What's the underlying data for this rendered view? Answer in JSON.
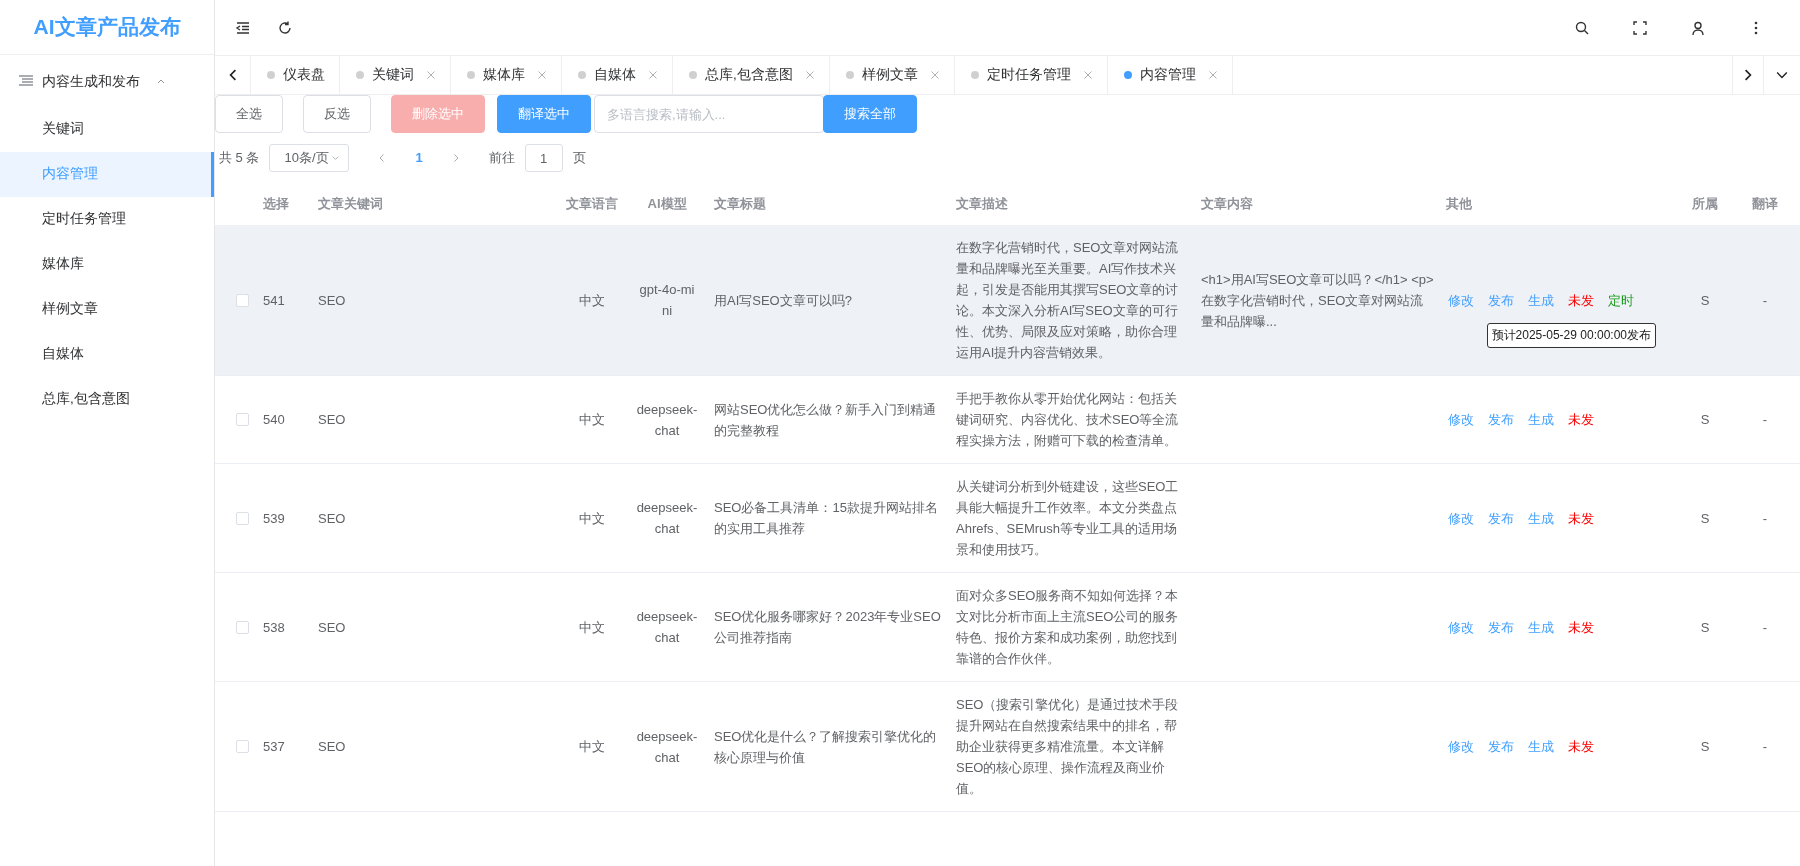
{
  "app_title": "AI文章产品发布",
  "sidebar": {
    "group": {
      "label": "内容生成和发布",
      "expanded": true
    },
    "items": [
      {
        "label": "关键词",
        "selected": false
      },
      {
        "label": "内容管理",
        "selected": true
      },
      {
        "label": "定时任务管理",
        "selected": false
      },
      {
        "label": "媒体库",
        "selected": false
      },
      {
        "label": "样例文章",
        "selected": false
      },
      {
        "label": "自媒体",
        "selected": false
      },
      {
        "label": "总库,包含意图",
        "selected": false
      }
    ]
  },
  "tabs": [
    {
      "label": "仪表盘",
      "selected": false,
      "closable": false
    },
    {
      "label": "关键词",
      "selected": false,
      "closable": true
    },
    {
      "label": "媒体库",
      "selected": false,
      "closable": true
    },
    {
      "label": "自媒体",
      "selected": false,
      "closable": true
    },
    {
      "label": "总库,包含意图",
      "selected": false,
      "closable": true
    },
    {
      "label": "样例文章",
      "selected": false,
      "closable": true
    },
    {
      "label": "定时任务管理",
      "selected": false,
      "closable": true
    },
    {
      "label": "内容管理",
      "selected": true,
      "closable": true
    }
  ],
  "toolbar": {
    "buttons": [
      {
        "label": "全选",
        "kind": "default",
        "disabled": false
      },
      {
        "label": "反选",
        "kind": "default",
        "disabled": false
      },
      {
        "label": "删除选中",
        "kind": "danger",
        "disabled": true
      },
      {
        "label": "翻译选中",
        "kind": "primary",
        "disabled": false
      }
    ],
    "search": {
      "placeholder": "多语言搜索,请输入..."
    },
    "search_button": "搜索全部"
  },
  "pagination": {
    "total": "共 5 条",
    "page_size": "10条/页",
    "current_page": "1",
    "goto_label": "前往",
    "goto_value": "1",
    "page_suffix": "页"
  },
  "table": {
    "columns": [
      "选择",
      "文章关键词",
      "文章语言",
      "AI模型",
      "文章标题",
      "文章描述",
      "文章内容",
      "其他",
      "所属",
      "翻译"
    ],
    "rows": [
      {
        "id": "541",
        "checked": false,
        "highlighted": true,
        "keyword": "SEO",
        "language": "中文",
        "model": "gpt-4o-mini",
        "title": "用AI写SEO文章可以吗?",
        "description": "在数字化营销时代，SEO文章对网站流量和品牌曝光至关重要。AI写作技术兴起，引发是否能用其撰写SEO文章的讨论。本文深入分析AI写SEO文章的可行性、优势、局限及应对策略，助你合理运用AI提升内容营销效果。",
        "content": "<h1>用AI写SEO文章可以吗？</h1> <p>在数字化营销时代，SEO文章对网站流量和品牌曝...",
        "actions": [
          {
            "label": "修改",
            "kind": "link"
          },
          {
            "label": "发布",
            "kind": "link"
          },
          {
            "label": "生成",
            "kind": "link"
          },
          {
            "label": "未发",
            "kind": "unpublished"
          },
          {
            "label": "定时",
            "kind": "scheduled"
          }
        ],
        "tooltip": "预计2025-05-29 00:00:00发布",
        "owner": "S",
        "translation": "-"
      },
      {
        "id": "540",
        "checked": false,
        "highlighted": false,
        "keyword": "SEO",
        "language": "中文",
        "model": "deepseek-chat",
        "title": "网站SEO优化怎么做？新手入门到精通的完整教程",
        "description": "手把手教你从零开始优化网站：包括关键词研究、内容优化、技术SEO等全流程实操方法，附赠可下载的检查清单。",
        "actions": [
          {
            "label": "修改",
            "kind": "link"
          },
          {
            "label": "发布",
            "kind": "link"
          },
          {
            "label": "生成",
            "kind": "link"
          },
          {
            "label": "未发",
            "kind": "unpublished"
          }
        ],
        "owner": "S",
        "translation": "-"
      },
      {
        "id": "539",
        "checked": false,
        "highlighted": false,
        "keyword": "SEO",
        "language": "中文",
        "model": "deepseek-chat",
        "title": "SEO必备工具清单：15款提升网站排名的实用工具推荐",
        "description": "从关键词分析到外链建设，这些SEO工具能大幅提升工作效率。本文分类盘点Ahrefs、SEMrush等专业工具的适用场景和使用技巧。",
        "actions": [
          {
            "label": "修改",
            "kind": "link"
          },
          {
            "label": "发布",
            "kind": "link"
          },
          {
            "label": "生成",
            "kind": "link"
          },
          {
            "label": "未发",
            "kind": "unpublished"
          }
        ],
        "owner": "S",
        "translation": "-"
      },
      {
        "id": "538",
        "checked": false,
        "highlighted": false,
        "keyword": "SEO",
        "language": "中文",
        "model": "deepseek-chat",
        "title": "SEO优化服务哪家好？2023年专业SEO公司推荐指南",
        "description": "面对众多SEO服务商不知如何选择？本文对比分析市面上主流SEO公司的服务特色、报价方案和成功案例，助您找到靠谱的合作伙伴。",
        "actions": [
          {
            "label": "修改",
            "kind": "link"
          },
          {
            "label": "发布",
            "kind": "link"
          },
          {
            "label": "生成",
            "kind": "link"
          },
          {
            "label": "未发",
            "kind": "unpublished"
          }
        ],
        "owner": "S",
        "translation": "-"
      },
      {
        "id": "537",
        "checked": false,
        "highlighted": false,
        "keyword": "SEO",
        "language": "中文",
        "model": "deepseek-chat",
        "title": "SEO优化是什么？了解搜索引擎优化的核心原理与价值",
        "description": "SEO（搜索引擎优化）是通过技术手段提升网站在自然搜索结果中的排名，帮助企业获得更多精准流量。本文详解SEO的核心原理、操作流程及商业价值。",
        "actions": [
          {
            "label": "修改",
            "kind": "link"
          },
          {
            "label": "发布",
            "kind": "link"
          },
          {
            "label": "生成",
            "kind": "link"
          },
          {
            "label": "未发",
            "kind": "unpublished"
          }
        ],
        "owner": "S",
        "translation": "-"
      }
    ]
  }
}
